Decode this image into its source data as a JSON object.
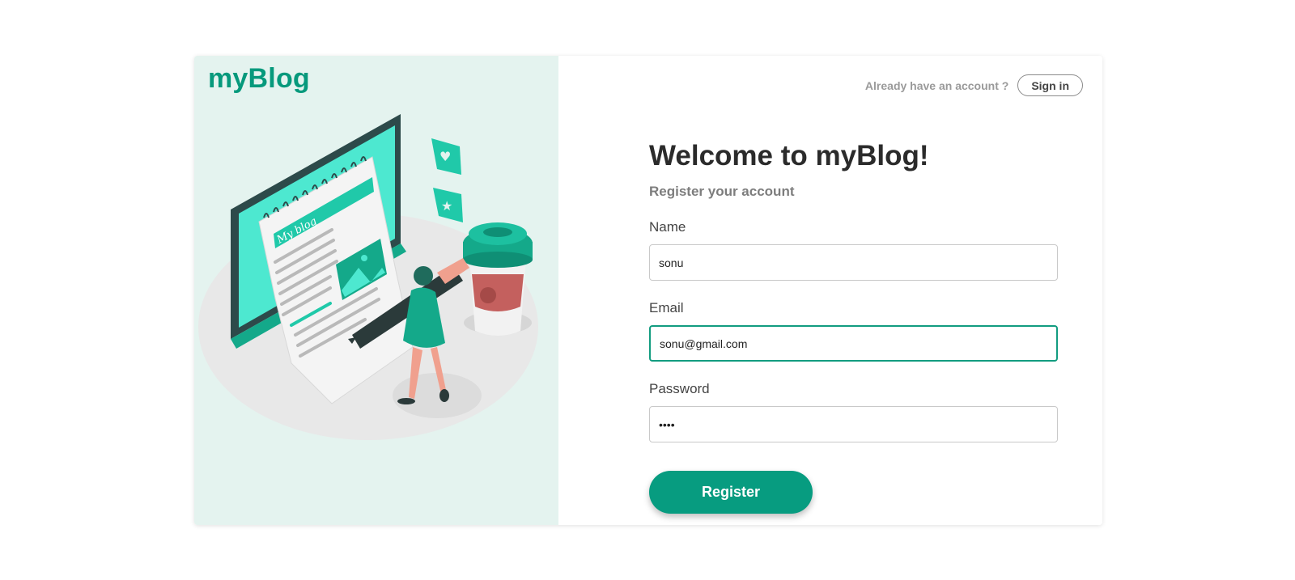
{
  "brand": {
    "name": "myBlog"
  },
  "illustration": {
    "notepad_text": "My blog"
  },
  "header": {
    "signin_prompt": "Already have an account ?",
    "signin_label": "Sign in"
  },
  "form": {
    "title": "Welcome to myBlog!",
    "subtitle": "Register your account",
    "fields": {
      "name": {
        "label": "Name",
        "value": "sonu"
      },
      "email": {
        "label": "Email",
        "value": "sonu@gmail.com"
      },
      "password": {
        "label": "Password",
        "value": "abcd"
      }
    },
    "submit_label": "Register"
  },
  "colors": {
    "accent": "#079c80",
    "left_panel_bg": "#e4f3ef",
    "brand_text": "#06997c"
  }
}
